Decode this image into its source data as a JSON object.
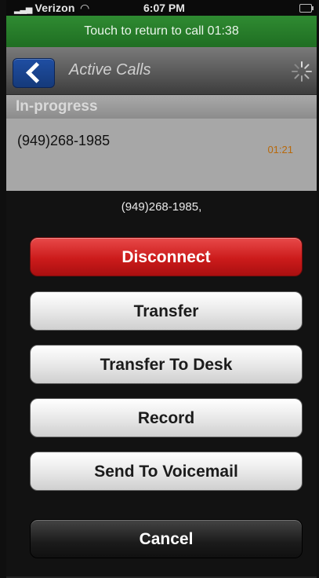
{
  "status_bar": {
    "carrier": "Verizon",
    "time": "6:07 PM"
  },
  "call_banner": {
    "text": "Touch to return to call  01:38"
  },
  "nav": {
    "title": "Active Calls"
  },
  "section": {
    "header": "In-progress"
  },
  "calls": [
    {
      "number": "(949)268-1985",
      "duration": "01:21"
    }
  ],
  "action_sheet": {
    "title": "(949)268-1985,",
    "buttons": [
      {
        "label": "Disconnect"
      },
      {
        "label": "Transfer"
      },
      {
        "label": "Transfer To Desk"
      },
      {
        "label": "Record"
      },
      {
        "label": "Send To Voicemail"
      },
      {
        "label": "Cancel"
      }
    ]
  },
  "colors": {
    "call_banner": "#2f8b32",
    "destructive": "#cc1b1b",
    "back_button": "#1f4ea3",
    "duration_text": "#b8690b"
  },
  "icons": [
    "wifi-icon",
    "signal-icon",
    "battery-icon",
    "back-arrow-icon",
    "spinner-icon"
  ]
}
